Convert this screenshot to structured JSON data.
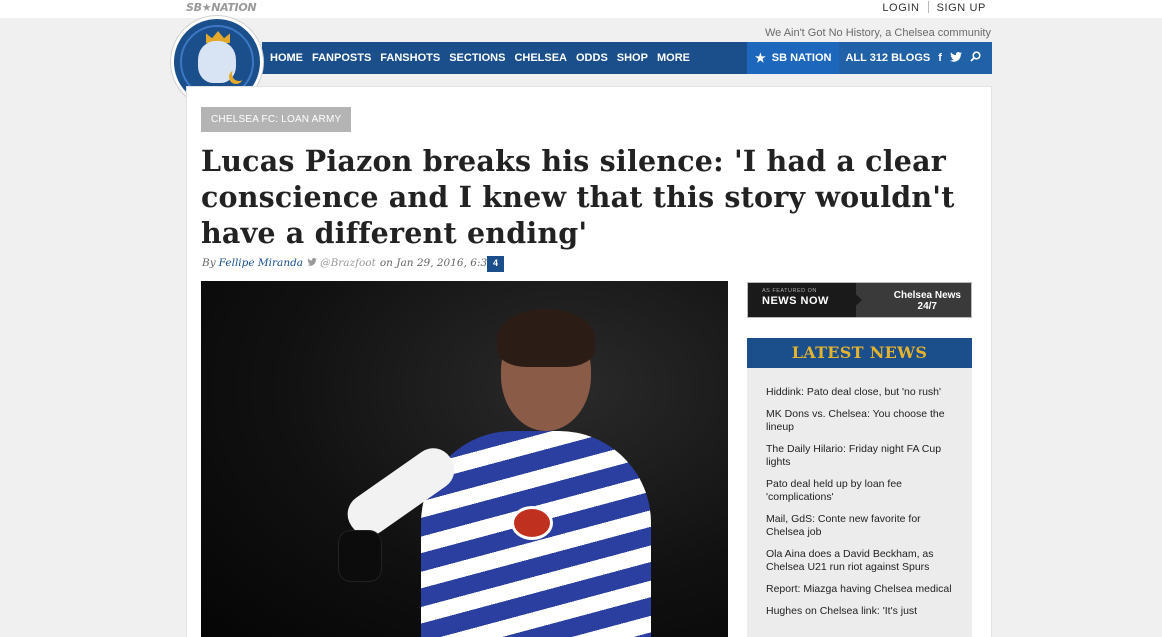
{
  "top": {
    "brand": "SB★NATION",
    "login": "LOGIN",
    "signup": "SIGN UP",
    "tagline": "We Ain't Got No History, a Chelsea community"
  },
  "nav": {
    "items": [
      "HOME",
      "FANPOSTS",
      "FANSHOTS",
      "SECTIONS",
      "CHELSEA",
      "ODDS",
      "SHOP",
      "MORE"
    ],
    "sbnation": "SB NATION",
    "all_blogs": "ALL 312 BLOGS",
    "facebook": "f",
    "twitter": "🐦",
    "search": "⌕"
  },
  "article": {
    "category": "CHELSEA FC: LOAN ARMY",
    "headline": "Lucas Piazon breaks his silence: 'I had a clear conscience and I knew that this story wouldn't have a different ending'",
    "by": "By",
    "author": "Fellipe Miranda",
    "handle": "@Brazfoot",
    "date": "on Jan 29, 2016, 6:34a",
    "comments": "4"
  },
  "sidebar": {
    "newsnow_small": "AS FEATURED ON",
    "newsnow_big": "NEWS NOW",
    "newsnow_line1": "Chelsea News",
    "newsnow_line2": "24/7",
    "latest_title": "LATEST NEWS",
    "latest": [
      "Hiddink: Pato deal close, but 'no rush'",
      "MK Dons vs. Chelsea: You choose the lineup",
      "The Daily Hilario: Friday night FA Cup lights",
      "Pato deal held up by loan fee 'complications'",
      "Mail, GdS: Conte new favorite for Chelsea job",
      "Ola Aina does a David Beckham, as Chelsea U21 run riot against Spurs",
      "Report: Miazga having Chelsea medical",
      "Hughes on Chelsea link: 'It's just"
    ]
  },
  "colors": {
    "nav_blue": "#1a4f8c",
    "accent_gold": "#e5b22e",
    "tag_gray": "#b4b4b4"
  }
}
